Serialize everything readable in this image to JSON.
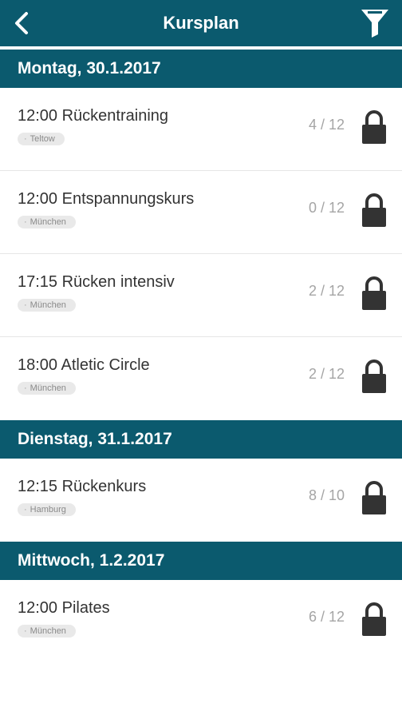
{
  "header": {
    "title": "Kursplan",
    "back_icon": "chevron-left-icon",
    "filter_icon": "funnel-icon",
    "color": "#0b5a6e"
  },
  "days": [
    {
      "label": "Montag, 30.1.2017",
      "courses": [
        {
          "title": "12:00 Rückentraining",
          "location": "Teltow",
          "count": "4 / 12"
        },
        {
          "title": "12:00 Entspannungskurs",
          "location": "München",
          "count": "0 / 12"
        },
        {
          "title": "17:15 Rücken intensiv",
          "location": "München",
          "count": "2 / 12"
        },
        {
          "title": "18:00 Atletic Circle",
          "location": "München",
          "count": "2 / 12"
        }
      ]
    },
    {
      "label": "Dienstag, 31.1.2017",
      "courses": [
        {
          "title": "12:15 Rückenkurs",
          "location": "Hamburg",
          "count": "8 / 10"
        }
      ]
    },
    {
      "label": "Mittwoch, 1.2.2017",
      "courses": [
        {
          "title": "12:00 Pilates",
          "location": "München",
          "count": "6 / 12"
        }
      ]
    }
  ]
}
